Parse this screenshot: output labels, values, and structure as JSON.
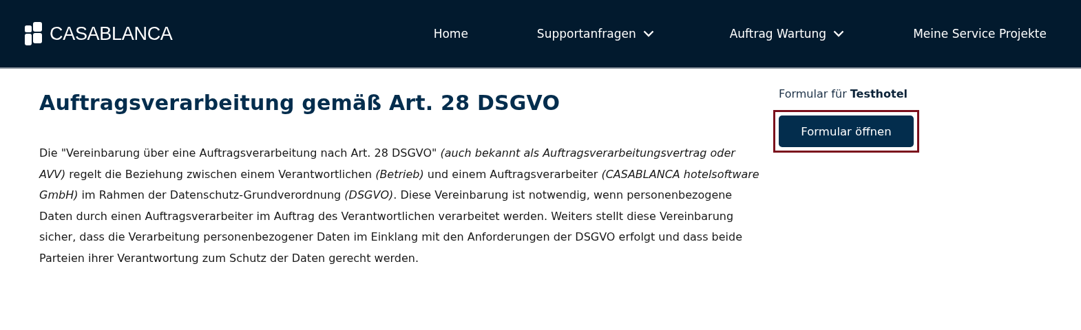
{
  "header": {
    "logo_text": "CASABLANCA",
    "nav": [
      {
        "label": "Home",
        "dropdown": false
      },
      {
        "label": "Supportanfragen",
        "dropdown": true
      },
      {
        "label": "Auftrag Wartung",
        "dropdown": true
      },
      {
        "label": "Meine Service Projekte",
        "dropdown": false
      }
    ]
  },
  "main": {
    "title": "Auftragsverarbeitung gemäß Art. 28 DSGVO",
    "paragraph": "Die \"Vereinbarung über eine Auftragsverarbeitung nach Art. 28 DSGVO\" *(auch bekannt als Auftragsverarbeitungsvertrag oder AVV)* regelt die Beziehung zwischen einem Verantwortlichen *(Betrieb)* und einem Auftragsverarbeiter *(CASABLANCA hotelsoftware GmbH)* im Rahmen der Datenschutz-Grundverordnung *(DSGVO)*. Diese Vereinbarung ist notwendig, wenn personenbezogene Daten durch einen Auftragsverarbeiter im Auftrag des Verantwortlichen verarbeitet werden. Weiters stellt diese Vereinbarung sicher, dass die Verarbeitung personenbezogener Daten im Einklang mit den Anforderungen der DSGVO erfolgt und dass beide Parteien ihrer Verantwortung zum Schutz der Daten gerecht werden."
  },
  "side": {
    "caption": "Formular für **Testhotel**",
    "button": {
      "label": "Formular öffnen",
      "highlighted": true
    }
  }
}
